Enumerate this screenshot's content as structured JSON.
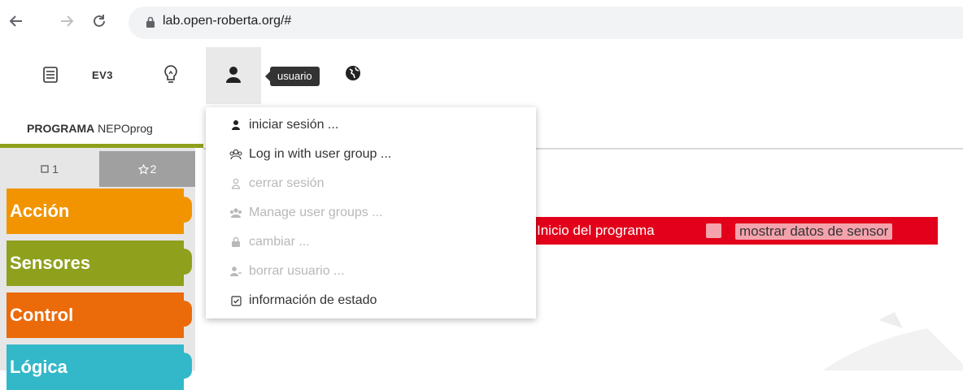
{
  "browser": {
    "url": "lab.open-roberta.org/#"
  },
  "toolbar": {
    "robot_label": "EV3",
    "user_tooltip": "usuario"
  },
  "program": {
    "tab_label": "PROGRAMA",
    "tab_name": "NEPOprog"
  },
  "toolbox": {
    "levels": [
      {
        "label": "1",
        "icon": "square-icon"
      },
      {
        "label": "2",
        "icon": "star-icon"
      }
    ],
    "categories": [
      {
        "label": "Acción",
        "color": "#f29400"
      },
      {
        "label": "Sensores",
        "color": "#8fa01d"
      },
      {
        "label": "Control",
        "color": "#eb6a0a"
      },
      {
        "label": "Lógica",
        "color": "#33b8ca"
      }
    ]
  },
  "user_menu": {
    "items": [
      {
        "label": "iniciar sesión ...",
        "icon": "user-icon",
        "enabled": true
      },
      {
        "label": "Log in with user group ...",
        "icon": "user-group-icon",
        "enabled": true
      },
      {
        "label": "cerrar sesión",
        "icon": "user-outline-icon",
        "enabled": false
      },
      {
        "label": "Manage user groups ...",
        "icon": "users-icon",
        "enabled": false
      },
      {
        "label": "cambiar ...",
        "icon": "lock-icon",
        "enabled": false
      },
      {
        "label": "borrar usuario ...",
        "icon": "user-minus-icon",
        "enabled": false
      },
      {
        "label": "información de estado",
        "icon": "checkbox-icon",
        "enabled": true
      }
    ]
  },
  "canvas": {
    "start_block_label": "Inicio del programa",
    "sensor_option_label": "mostrar datos de sensor"
  },
  "colors": {
    "start_block": "#e2001a",
    "menu_disabled": "#b8b8b8"
  }
}
